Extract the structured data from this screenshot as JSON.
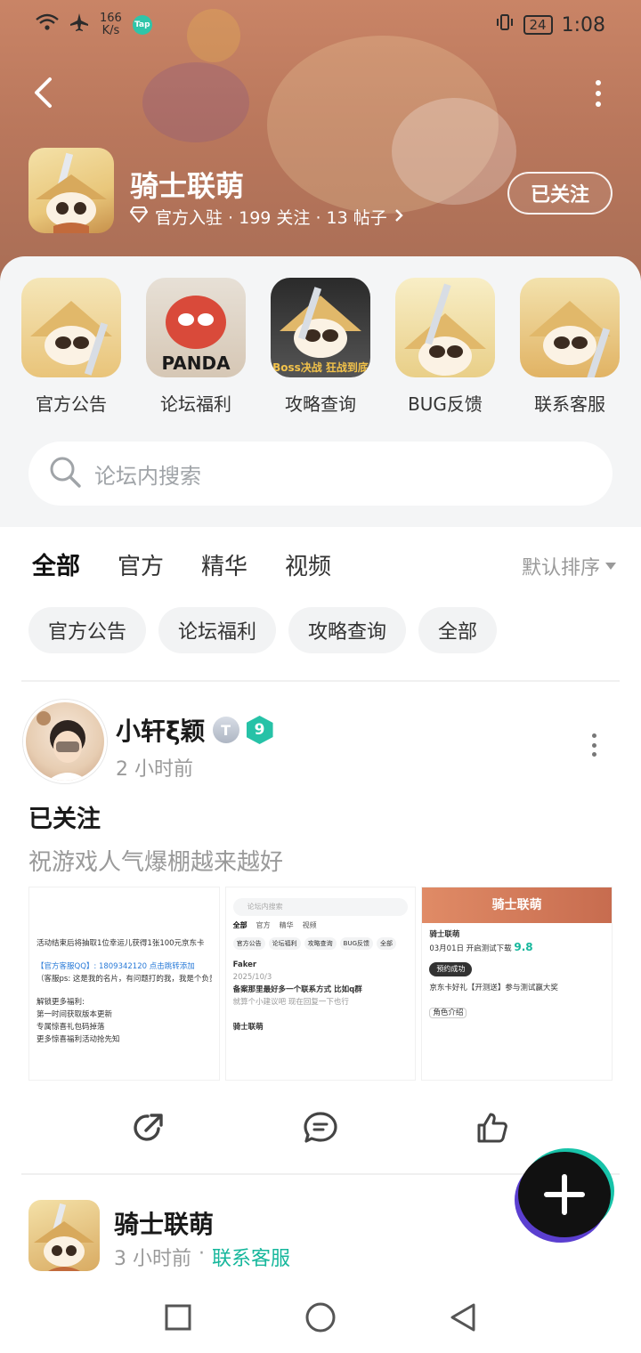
{
  "status_bar": {
    "net_speed_value": "166",
    "net_speed_unit": "K/s",
    "tap_badge": "Tap",
    "battery": "24",
    "time": "1:08"
  },
  "header": {
    "forum_name": "骑士联萌",
    "meta": "官方入驻 · 199 关注 · 13 帖子",
    "follow_label": "已关注"
  },
  "shortcuts": [
    {
      "label": "官方公告",
      "icon": "announcement-icon"
    },
    {
      "label": "论坛福利",
      "icon": "welfare-icon",
      "caption": "PANDA"
    },
    {
      "label": "攻略查询",
      "icon": "guide-icon",
      "caption": "Boss决战 狂战到底"
    },
    {
      "label": "BUG反馈",
      "icon": "bug-feedback-icon"
    },
    {
      "label": "联系客服",
      "icon": "customer-service-icon"
    }
  ],
  "search": {
    "placeholder": "论坛内搜索"
  },
  "tabs": [
    "全部",
    "官方",
    "精华",
    "视频"
  ],
  "sort_label": "默认排序",
  "chips": [
    "官方公告",
    "论坛福利",
    "攻略查询",
    "全部"
  ],
  "post1": {
    "author": "小轩ξ颖",
    "level_badge": "T",
    "rank": "9",
    "time": "2 小时前",
    "title": "已关注",
    "body": "祝游戏人气爆棚越来越好",
    "shot1": {
      "lines": [
        "活动结束后将抽取1位幸运儿获得1张100元京东卡",
        "【官方客服QQ】: 1809342120 点击跳转添加",
        "（客服ps: 这是我的名片，有问题打的我，我是个负责的人）",
        "解锁更多福利:",
        "第一时间获取版本更新",
        "专属惊喜礼包码掉落",
        "更多惊喜福利活动抢先知"
      ]
    },
    "shot2": {
      "search": "论坛内搜索",
      "tabs": [
        "全部",
        "官方",
        "精华",
        "视频"
      ],
      "chips": [
        "官方公告",
        "论坛福利",
        "攻略查询",
        "BUG反馈",
        "全部"
      ],
      "author": "Faker",
      "date": "2025/10/3",
      "title": "备案那里最好多一个联系方式 比如q群",
      "body": "就算个小建议吧 现在回复一下也行",
      "footer": "骑士联萌"
    },
    "shot3": {
      "banner": "骑士联萌",
      "name": "骑士联萌",
      "date": "03月01日 开启测试下载",
      "score": "9.8",
      "toast": "预约成功",
      "note": "京东卡好礼【开测送】参与测试赢大奖",
      "tag": "角色介绍"
    }
  },
  "post2": {
    "author": "骑士联萌",
    "time": "3 小时前",
    "tag": "联系客服"
  },
  "colors": {
    "accent": "#16c3b0",
    "banner": "#b9775c",
    "panel": "#f4f5f6"
  }
}
